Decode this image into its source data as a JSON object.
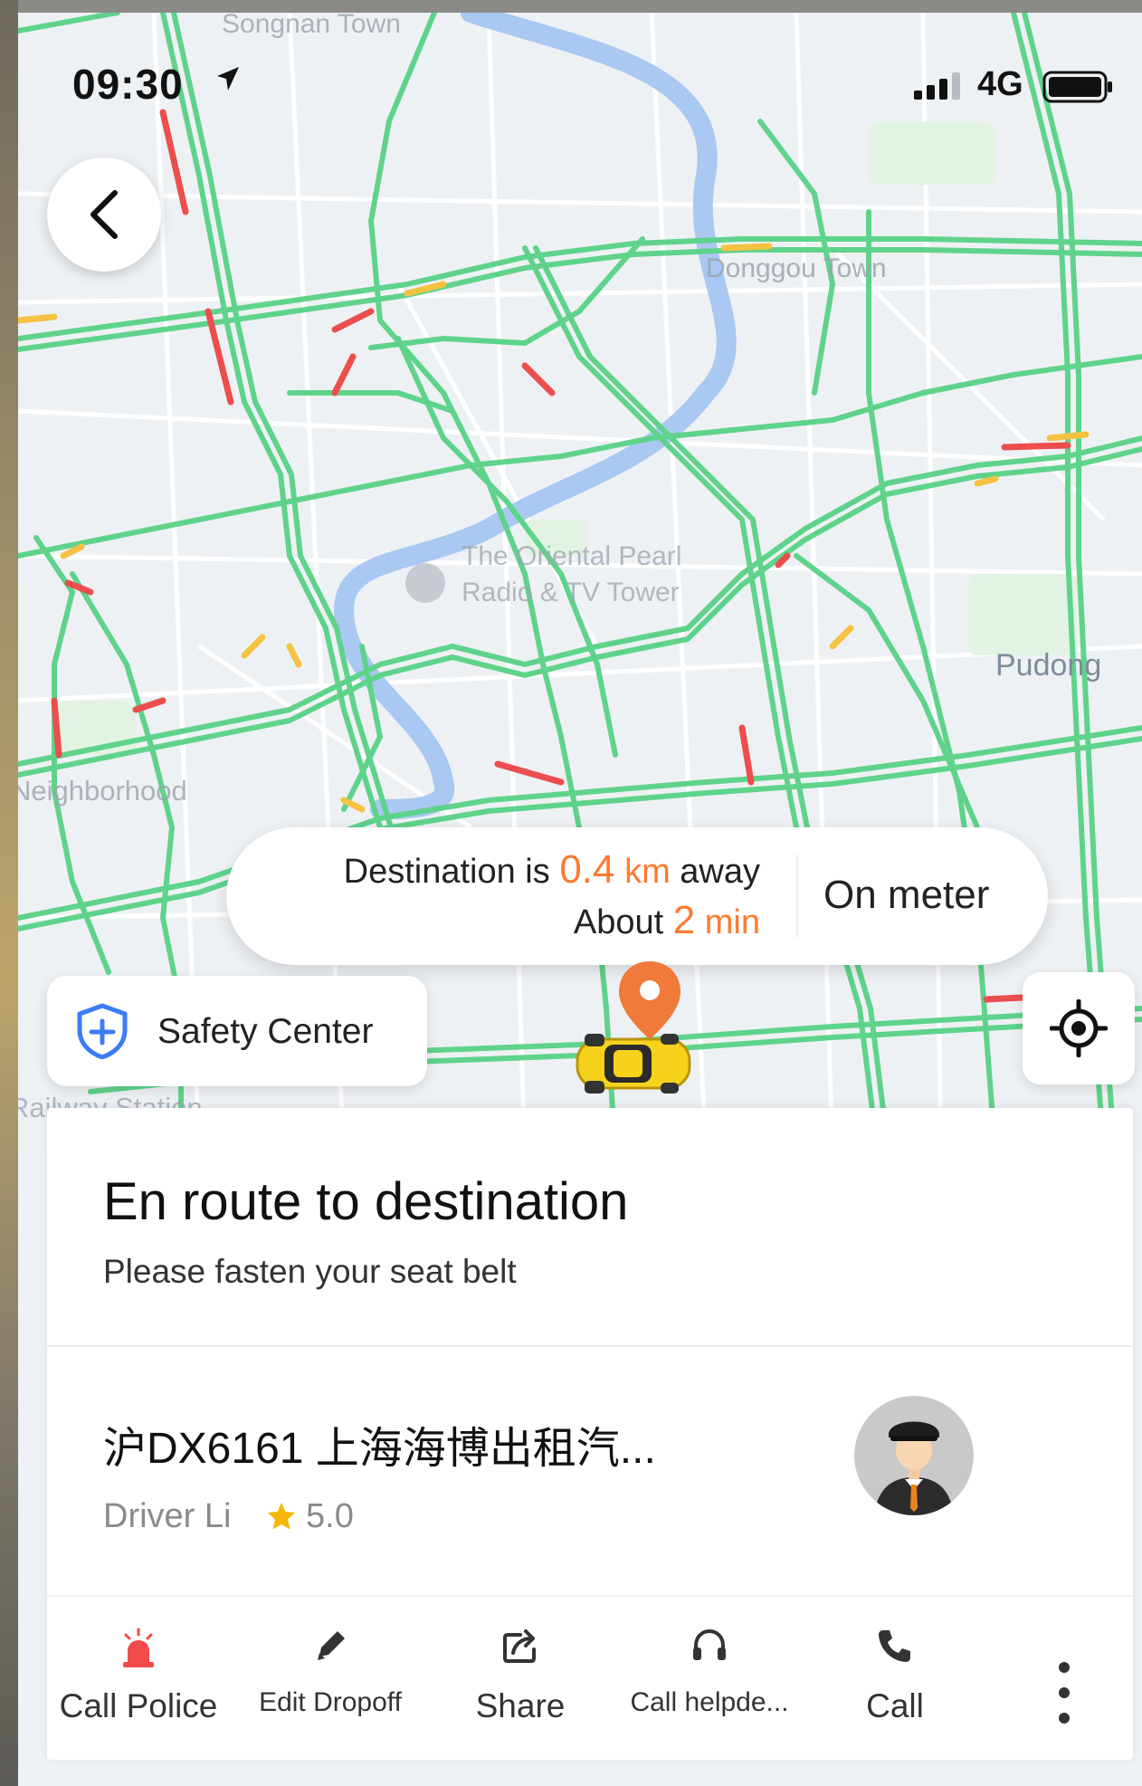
{
  "status_bar": {
    "time": "09:30",
    "network": "4G",
    "icons": [
      "location-arrow-icon",
      "signal-icon",
      "battery-icon"
    ]
  },
  "map": {
    "labels": [
      "Songnan Town",
      "Donggou Town",
      "The Oriental Pearl Radio & TV Tower",
      "Pudong",
      "Neighborhood",
      "Railway Station"
    ],
    "traffic_colors": {
      "clear": "#5fd38b",
      "slow": "#f5c242",
      "congested": "#ec4e4e"
    },
    "river_color": "#a9c8f2"
  },
  "trip_bubble": {
    "dest_prefix": "Destination is",
    "distance_value": "0.4",
    "distance_unit": "km",
    "dest_suffix": "away",
    "eta_prefix": "About",
    "eta_value": "2",
    "eta_unit": "min",
    "meter_label": "On meter",
    "accent_color": "#ff7a2f"
  },
  "safety_center": {
    "label": "Safety Center",
    "icon": "shield-plus-icon",
    "color": "#3b7cf6"
  },
  "trip_status": {
    "title": "En route to destination",
    "subtitle": "Please fasten your seat belt"
  },
  "driver": {
    "plate_and_company": "沪DX6161  上海海博出租汽...",
    "name": "Driver Li",
    "rating": "5.0"
  },
  "actions": [
    {
      "label": "Call Police",
      "icon": "siren-icon"
    },
    {
      "label": "Edit Dropoff",
      "icon": "pencil-icon"
    },
    {
      "label": "Share",
      "icon": "share-icon"
    },
    {
      "label": "Call helpde...",
      "icon": "headset-icon"
    },
    {
      "label": "Call",
      "icon": "phone-icon"
    }
  ]
}
